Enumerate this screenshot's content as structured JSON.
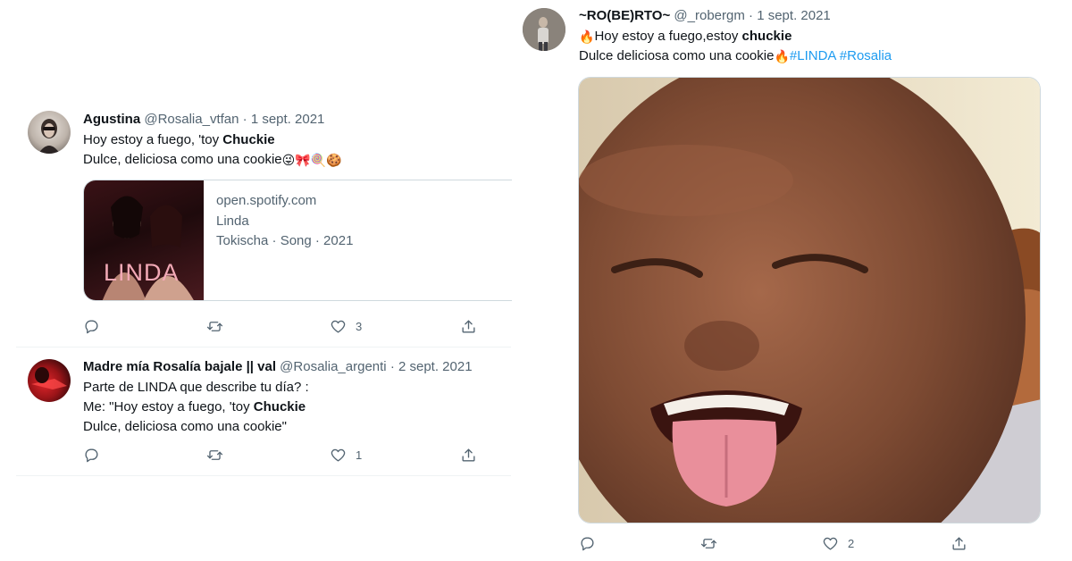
{
  "tweet1": {
    "name": "Agustina",
    "handle": "@Rosalia_vtfan",
    "date": "1 sept. 2021",
    "line1_pre": "Hoy estoy a fuego, 'toy ",
    "line1_bold": "Chuckie",
    "line2": "Dulce, deliciosa como una cookie",
    "line2_emoji": "😜🎀🍭🍪",
    "card": {
      "domain": "open.spotify.com",
      "title": "Linda",
      "subtitle": "Tokischa · Song · 2021",
      "cover_text": "LINDA"
    },
    "likes": "3"
  },
  "tweet2": {
    "name": "Madre mía Rosalía bajale || val",
    "handle": "@Rosalia_argenti",
    "date": "2 sept. 2021",
    "line1": "Parte de LINDA que describe tu día? :",
    "line2_pre": "Me: \"Hoy estoy a fuego, 'toy ",
    "line2_bold": "Chuckie",
    "line3": "Dulce, deliciosa como una cookie\"",
    "likes": "1"
  },
  "tweet3": {
    "name": "~RO(BE)RTO~",
    "handle": "@_robergm",
    "date": "1 sept. 2021",
    "line1_emoji": "🔥",
    "line1_pre": "Hoy estoy a fuego,estoy ",
    "line1_bold": "chuckie",
    "line2_pre": "Dulce deliciosa como una cookie",
    "line2_emoji": "🔥",
    "hashtag1": "#LINDA",
    "hashtag2": "#Rosalia",
    "likes": "2"
  },
  "colors": {
    "accent": "#1d9bf0",
    "text": "#0f1419",
    "muted": "#536471",
    "divider": "#eff3f4"
  }
}
